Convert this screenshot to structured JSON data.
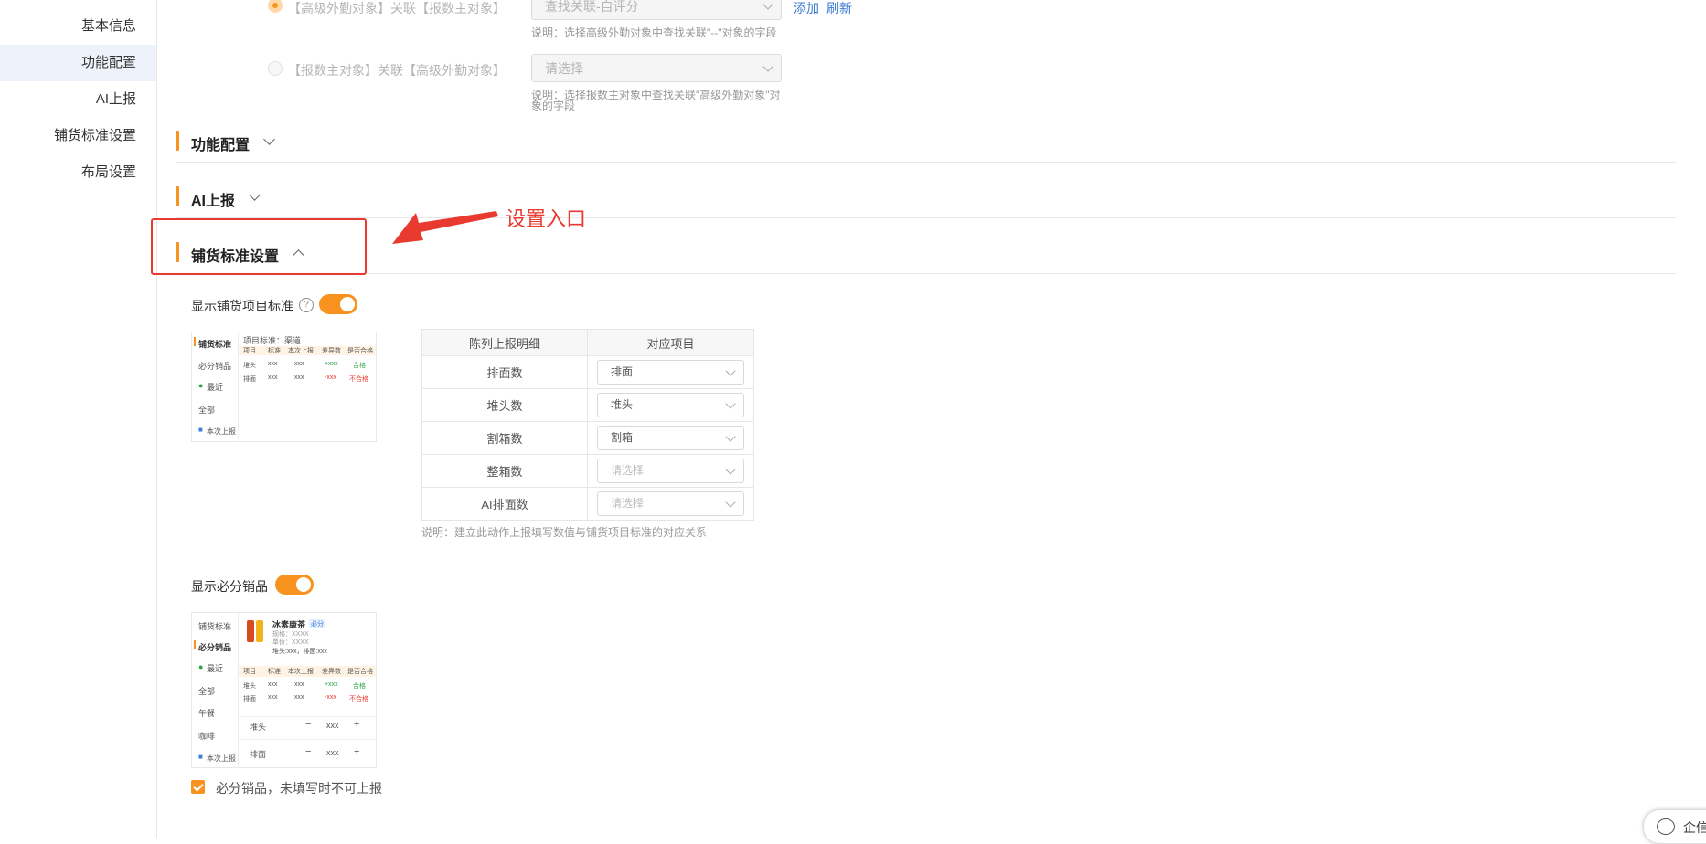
{
  "sidebar": {
    "items": [
      {
        "label": "基本信息"
      },
      {
        "label": "功能配置"
      },
      {
        "label": "AI上报"
      },
      {
        "label": "铺货标准设置"
      },
      {
        "label": "布局设置"
      }
    ]
  },
  "relation": {
    "row1": {
      "label": "【高级外勤对象】关联【报数主对象】",
      "value": "查找关联-自评分",
      "add": "添加",
      "refresh": "刷新",
      "note": "说明：选择高级外勤对象中查找关联\"--\"对象的字段"
    },
    "row2": {
      "label": "【报数主对象】关联【高级外勤对象】",
      "placeholder": "请选择",
      "note_line1": "说明：选择报数主对象中查找关联\"高级外勤对象\"对",
      "note_line2": "象的字段"
    }
  },
  "sections": {
    "func": "功能配置",
    "ai": "AI上报",
    "display": "铺货标准设置"
  },
  "annotation": {
    "text": "设置入口",
    "color": "#e83a2f"
  },
  "display_standard": {
    "label": "显示铺货项目标准",
    "help": "?",
    "table": {
      "headers": [
        "陈列上报明细",
        "对应项目"
      ],
      "rows": [
        {
          "name": "排面数",
          "value": "排面",
          "placeholder": false
        },
        {
          "name": "堆头数",
          "value": "堆头",
          "placeholder": false
        },
        {
          "name": "割箱数",
          "value": "割箱",
          "placeholder": false
        },
        {
          "name": "整箱数",
          "value": "请选择",
          "placeholder": true
        },
        {
          "name": "AI排面数",
          "value": "请选择",
          "placeholder": true
        }
      ],
      "note": "说明：建立此动作上报填写数值与铺货项目标准的对应关系"
    },
    "thumb": {
      "tabs": [
        "铺货标准",
        "必分销品",
        "最近",
        "全部",
        "本次上报"
      ],
      "header": "项目标准：渠道",
      "cols": [
        "项目",
        "标准",
        "本次上报",
        "差异数",
        "是否合格"
      ],
      "rows": [
        [
          "堆头",
          "xxx",
          "xxx",
          "+xxx",
          "合格"
        ],
        [
          "排面",
          "xxx",
          "xxx",
          "-xxx",
          "不合格"
        ]
      ]
    }
  },
  "must_sell": {
    "label": "显示必分销品",
    "checkbox_label": "必分销品，未填写时不可上报",
    "thumb": {
      "tabs": [
        "铺货标准",
        "必分销品",
        "最近",
        "全部",
        "午餐",
        "咖啡",
        "本次上报"
      ],
      "product": "冰素康茶",
      "tag": "必分",
      "meta1": "规格：XXXX",
      "meta2": "单价：XXXX",
      "meta3": "堆头:xxx，排面:xxx",
      "cols": [
        "项目",
        "标准",
        "本次上报",
        "差异数",
        "是否合格"
      ],
      "rows": [
        [
          "堆头",
          "xxx",
          "xxx",
          "+xxx",
          "合格"
        ],
        [
          "排面",
          "xxx",
          "xxx",
          "-xxx",
          "不合格"
        ]
      ],
      "steppers": [
        {
          "name": "堆头",
          "value": "xxx"
        },
        {
          "name": "排面",
          "value": "xxx"
        }
      ]
    }
  },
  "footer": {
    "chat_label": "企信"
  },
  "colors": {
    "accent": "#f7931e",
    "link": "#3a7bd5"
  }
}
